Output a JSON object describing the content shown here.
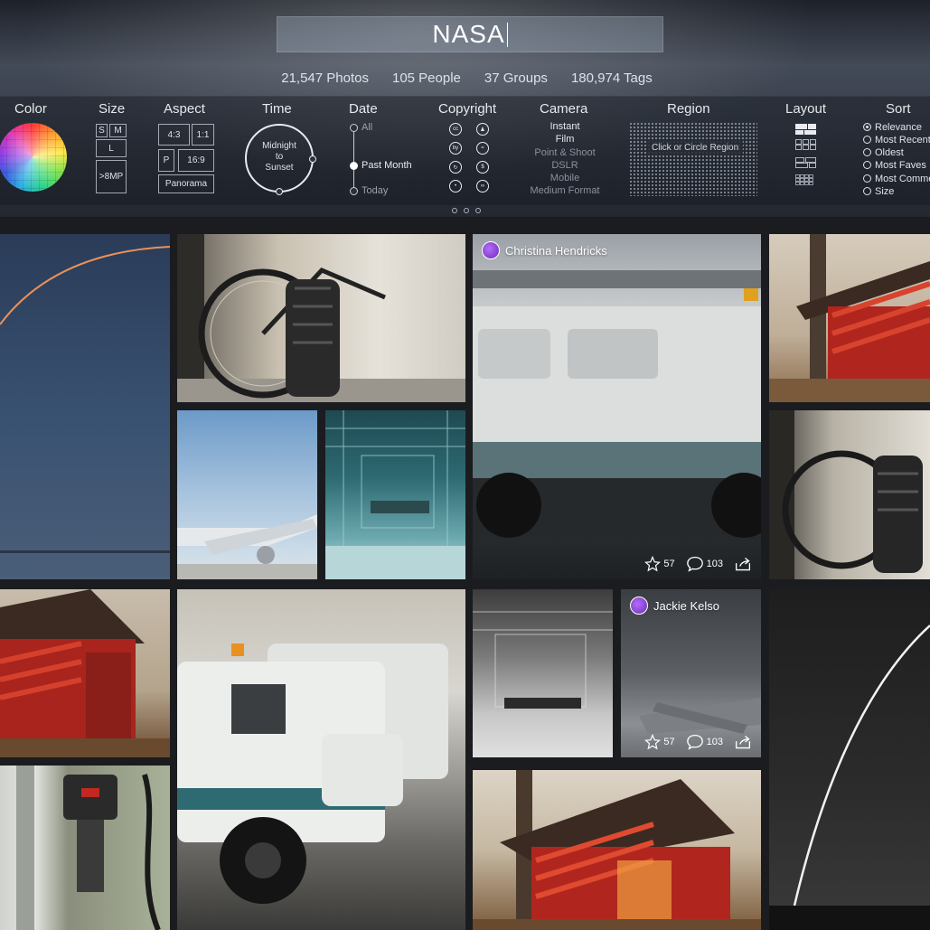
{
  "search": {
    "query": "NASA"
  },
  "stats": {
    "photos": "21,547 Photos",
    "people": "105 People",
    "groups": "37 Groups",
    "tags": "180,974 Tags"
  },
  "filters": {
    "color": {
      "label": "Color"
    },
    "size": {
      "label": "Size",
      "options": [
        "S",
        "M",
        "L",
        ">8MP"
      ]
    },
    "aspect": {
      "label": "Aspect",
      "options": [
        "4:3",
        "1:1",
        "P",
        "16:9",
        "Panorama"
      ]
    },
    "time": {
      "label": "Time",
      "line1": "Midnight",
      "line2": "to",
      "line3": "Sunset"
    },
    "date": {
      "label": "Date",
      "options": [
        "All",
        "Past Month",
        "Today"
      ],
      "selected": "Past Month"
    },
    "copyright": {
      "label": "Copyright"
    },
    "camera": {
      "label": "Camera",
      "options": [
        "Instant",
        "Film",
        "Point & Shoot",
        "DSLR",
        "Mobile",
        "Medium Format"
      ]
    },
    "region": {
      "label": "Region",
      "hint": "Click or Circle Region"
    },
    "layout": {
      "label": "Layout"
    },
    "sort": {
      "label": "Sort",
      "options": [
        "Relevance",
        "Most Recent",
        "Oldest",
        "Most Faves",
        "Most Comments",
        "Size"
      ],
      "selected": "Relevance"
    }
  },
  "photos": [
    {
      "author": "Christina Hendricks",
      "faves": "57",
      "comments": "103"
    },
    {
      "author": "Jackie Kelso",
      "faves": "57",
      "comments": "103"
    }
  ],
  "colors": {
    "accent": "#8a3cd6",
    "text": "#e8ebf0"
  }
}
